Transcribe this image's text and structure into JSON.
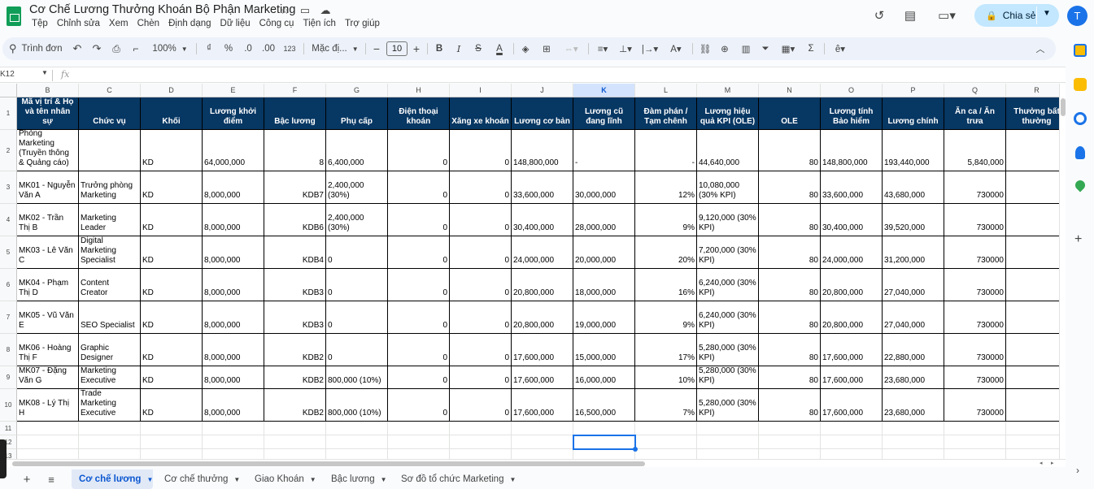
{
  "header": {
    "title": "Cơ Chế Lương Thưởng Khoán Bộ Phận Marketing",
    "menu": [
      "Tệp",
      "Chỉnh sửa",
      "Xem",
      "Chèn",
      "Định dạng",
      "Dữ liệu",
      "Công cụ",
      "Tiện ích",
      "Trợ giúp"
    ],
    "share_label": "Chia sẻ",
    "avatar_initial": "T"
  },
  "toolbar": {
    "search_label": "Trình đơn",
    "zoom": "100%",
    "currency": "₫",
    "percent": "%",
    "dec_decrease": ".0",
    "dec_increase": ".00",
    "number_format": "123",
    "font": "Mặc đị...",
    "font_size": "10"
  },
  "formula_bar": {
    "cell_ref": "K12",
    "formula": ""
  },
  "columns": [
    "B",
    "C",
    "D",
    "E",
    "F",
    "G",
    "H",
    "I",
    "J",
    "K",
    "L",
    "M",
    "N",
    "O",
    "P",
    "Q",
    "R"
  ],
  "selected_column": "K",
  "row_numbers": [
    "1",
    "2",
    "3",
    "4",
    "5",
    "6",
    "7",
    "8",
    "9",
    "10",
    "11",
    "12",
    "13"
  ],
  "headers": [
    "Mã vị trí & Họ và tên nhân sự",
    "Chức vụ",
    "Khối",
    "Lương khởi điểm",
    "Bậc lương",
    "Phụ cấp",
    "Điện thoại khoán",
    "Xăng xe khoán",
    "Lương cơ bản",
    "Lương cũ đang lĩnh",
    "Đàm phán / Tạm chênh",
    "Lương hiệu quả KPI (OLE)",
    "OLE",
    "Lương tính Bảo hiểm",
    "Lương chính",
    "Ăn ca / Ăn trưa",
    "Thưởng bất thường"
  ],
  "rows": [
    [
      "Phòng Marketing (Truyền thông & Quảng cáo)",
      "",
      "KD",
      "64,000,000",
      "8",
      "6,400,000",
      "0",
      "0",
      "148,800,000",
      "-",
      "-",
      "44,640,000",
      "80",
      "148,800,000",
      "193,440,000",
      "5,840,000",
      ""
    ],
    [
      "MK01 - Nguyễn Văn A",
      "Trưởng phòng Marketing",
      "KD",
      "8,000,000",
      "KDB7",
      "2,400,000 (30%)",
      "0",
      "0",
      "33,600,000",
      "30,000,000",
      "12%",
      "10,080,000 (30% KPI)",
      "80",
      "33,600,000",
      "43,680,000",
      "730000",
      ""
    ],
    [
      "MK02 - Trần Thị B",
      "Marketing Leader",
      "KD",
      "8,000,000",
      "KDB6",
      "2,400,000 (30%)",
      "0",
      "0",
      "30,400,000",
      "28,000,000",
      "9%",
      "9,120,000 (30% KPI)",
      "80",
      "30,400,000",
      "39,520,000",
      "730000",
      ""
    ],
    [
      "MK03 - Lê Văn C",
      "Digital Marketing Specialist",
      "KD",
      "8,000,000",
      "KDB4",
      "0",
      "0",
      "0",
      "24,000,000",
      "20,000,000",
      "20%",
      "7,200,000 (30% KPI)",
      "80",
      "24,000,000",
      "31,200,000",
      "730000",
      ""
    ],
    [
      "MK04 - Phạm Thị D",
      "Content Creator",
      "KD",
      "8,000,000",
      "KDB3",
      "0",
      "0",
      "0",
      "20,800,000",
      "18,000,000",
      "16%",
      "6,240,000 (30% KPI)",
      "80",
      "20,800,000",
      "27,040,000",
      "730000",
      ""
    ],
    [
      "MK05 - Vũ Văn E",
      "SEO Specialist",
      "KD",
      "8,000,000",
      "KDB3",
      "0",
      "0",
      "0",
      "20,800,000",
      "19,000,000",
      "9%",
      "6,240,000 (30% KPI)",
      "80",
      "20,800,000",
      "27,040,000",
      "730000",
      ""
    ],
    [
      "MK06 - Hoàng Thị F",
      "Graphic Designer",
      "KD",
      "8,000,000",
      "KDB2",
      "0",
      "0",
      "0",
      "17,600,000",
      "15,000,000",
      "17%",
      "5,280,000 (30% KPI)",
      "80",
      "17,600,000",
      "22,880,000",
      "730000",
      ""
    ],
    [
      "MK07 - Đặng Văn G",
      "Marketing Executive",
      "KD",
      "8,000,000",
      "KDB2",
      "800,000 (10%)",
      "0",
      "0",
      "17,600,000",
      "16,000,000",
      "10%",
      "5,280,000 (30% KPI)",
      "80",
      "17,600,000",
      "23,680,000",
      "730000",
      ""
    ],
    [
      "MK08 - Lý Thị H",
      "Trade Marketing Executive",
      "KD",
      "8,000,000",
      "KDB2",
      "800,000 (10%)",
      "0",
      "0",
      "17,600,000",
      "16,500,000",
      "7%",
      "5,280,000 (30% KPI)",
      "80",
      "17,600,000",
      "23,680,000",
      "730000",
      ""
    ]
  ],
  "sheet_tabs": [
    "Cơ chế lương",
    "Cơ chế thưởng",
    "Giao Khoán",
    "Bậc lương",
    "Sơ đồ tổ chức Marketing"
  ],
  "active_tab": "Cơ chế lương"
}
